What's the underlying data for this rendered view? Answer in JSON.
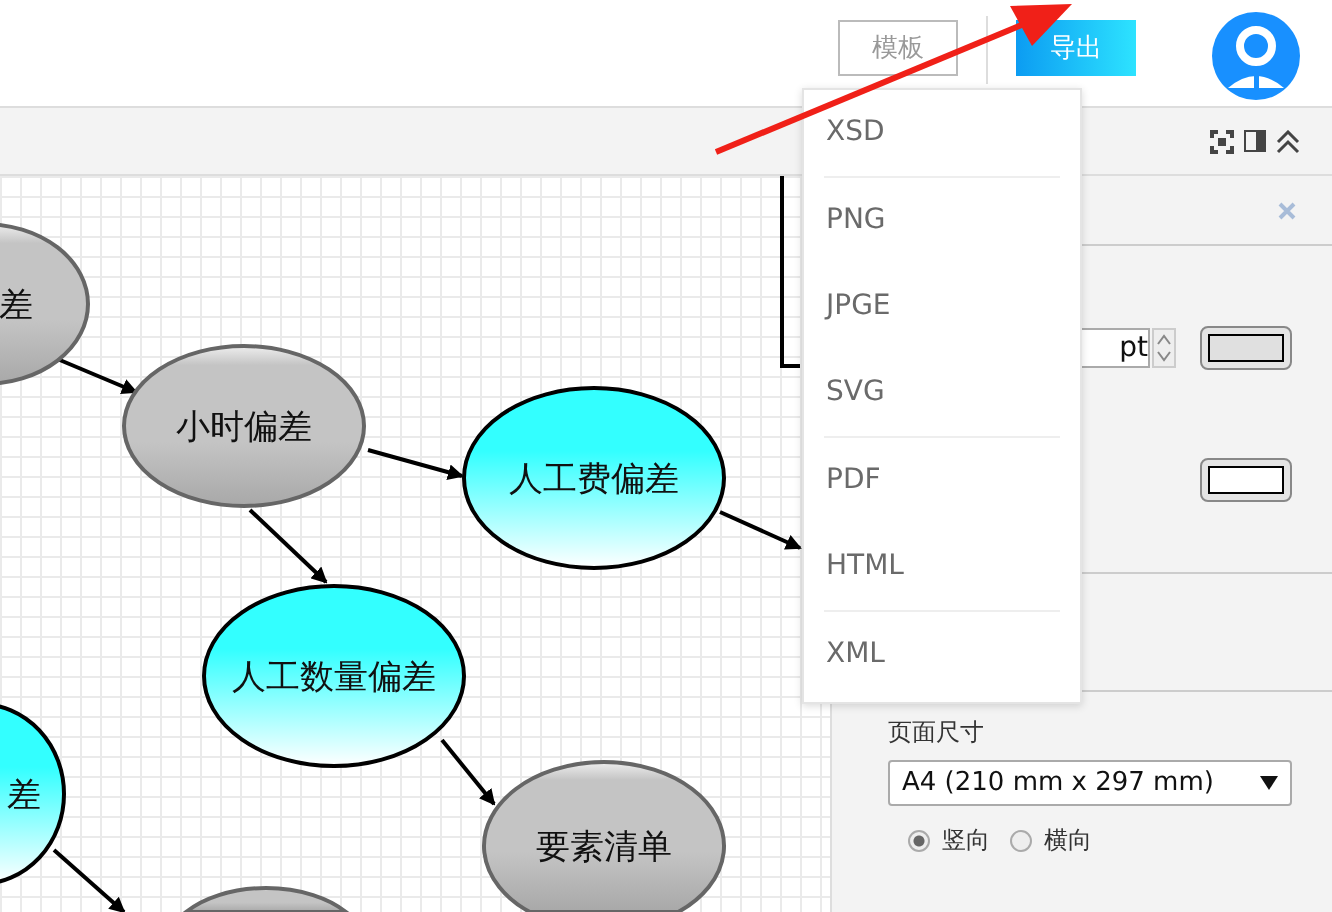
{
  "header": {
    "buttons": [
      {
        "label": "模板",
        "kind": "outline"
      },
      {
        "label": "导出",
        "kind": "primary"
      }
    ]
  },
  "export_menu": {
    "items": [
      {
        "label": "XSD",
        "separator_after": true
      },
      {
        "label": "PNG",
        "separator_after": false
      },
      {
        "label": "JPGE",
        "separator_after": false
      },
      {
        "label": "SVG",
        "separator_after": true
      },
      {
        "label": "PDF",
        "separator_after": false
      },
      {
        "label": "HTML",
        "separator_after": true
      },
      {
        "label": "XML",
        "separator_after": false
      }
    ]
  },
  "canvas": {
    "nodes": [
      {
        "label": "差",
        "color": "#c4c4c4"
      },
      {
        "label": "小时偏差",
        "color": "#c4c4c4"
      },
      {
        "label": "人工费偏差",
        "color": "#33ffff"
      },
      {
        "label": "人工数量偏差",
        "color": "#33ffff"
      },
      {
        "label": "要素清单",
        "color": "#c4c4c4"
      },
      {
        "label": "差",
        "color": "#33ffff"
      },
      {
        "color": "#c4c4c4"
      }
    ]
  },
  "panel": {
    "line_width": {
      "value": "pt"
    },
    "swatches": [
      {
        "color": "#e0e0e0"
      },
      {
        "color": "#ffffff"
      }
    ],
    "page_size": {
      "label": "页面尺寸",
      "value": "A4 (210 mm x 297 mm)"
    },
    "orientation": [
      {
        "label": "竖向",
        "selected": true
      },
      {
        "label": "横向",
        "selected": false
      }
    ]
  }
}
